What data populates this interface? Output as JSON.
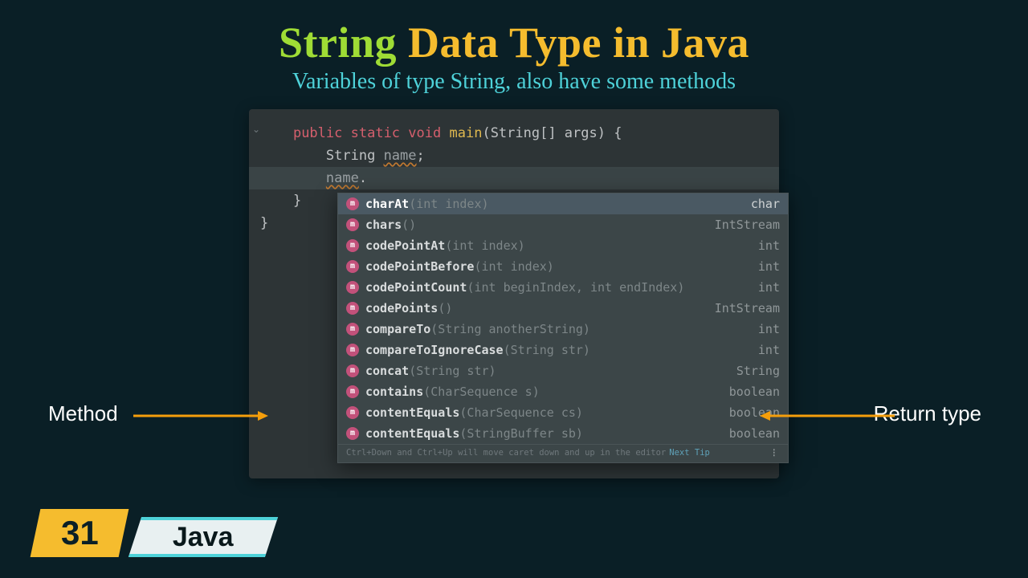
{
  "title": {
    "word1": "String",
    "word2": "Data Type in Java"
  },
  "subtitle": "Variables of type String, also have some methods",
  "code": {
    "line1_public": "public",
    "line1_static": "static",
    "line1_void": "void",
    "line1_main": "main",
    "line1_params": "(String[] args)",
    "line1_brace": " {",
    "line2_type": "String",
    "line2_var": "name",
    "line2_semi": ";",
    "line3_var": "name",
    "line3_dot": ".",
    "line4_brace": "}",
    "line5_brace": "}"
  },
  "autocomplete": {
    "items": [
      {
        "name": "charAt",
        "params": "(int index)",
        "ret": "char",
        "selected": true
      },
      {
        "name": "chars",
        "params": "()",
        "ret": "IntStream"
      },
      {
        "name": "codePointAt",
        "params": "(int index)",
        "ret": "int"
      },
      {
        "name": "codePointBefore",
        "params": "(int index)",
        "ret": "int"
      },
      {
        "name": "codePointCount",
        "params": "(int beginIndex, int endIndex)",
        "ret": "int"
      },
      {
        "name": "codePoints",
        "params": "()",
        "ret": "IntStream"
      },
      {
        "name": "compareTo",
        "params": "(String anotherString)",
        "ret": "int"
      },
      {
        "name": "compareToIgnoreCase",
        "params": "(String str)",
        "ret": "int"
      },
      {
        "name": "concat",
        "params": "(String str)",
        "ret": "String"
      },
      {
        "name": "contains",
        "params": "(CharSequence s)",
        "ret": "boolean"
      },
      {
        "name": "contentEquals",
        "params": "(CharSequence cs)",
        "ret": "boolean"
      },
      {
        "name": "contentEquals",
        "params": "(StringBuffer sb)",
        "ret": "boolean"
      }
    ],
    "hint_text": "Ctrl+Down and Ctrl+Up will move caret down and up in the editor",
    "hint_link": "Next Tip"
  },
  "labels": {
    "left": "Method",
    "right": "Return type"
  },
  "badges": {
    "number": "31",
    "lang": "Java"
  },
  "colors": {
    "accent_green": "#9fdc35",
    "accent_yellow": "#f5bc2e",
    "accent_cyan": "#4ed2d9",
    "arrow": "#f59e0b"
  }
}
